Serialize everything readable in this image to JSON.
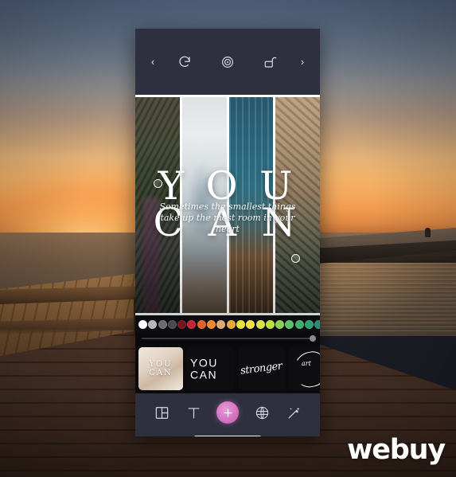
{
  "background": {
    "scene_description": "Sunset over a wooden pier boardwalk with sea wall and ocean",
    "watermark": "webuy",
    "sky_top_color": "#50617c",
    "sky_bottom_color": "#f5a85c",
    "deck_color": "#4c3427"
  },
  "app": {
    "topbar": {
      "back_arrow": "‹",
      "forward_arrow": "›",
      "icons": [
        {
          "name": "undo-redo-icon",
          "label": "Redo"
        },
        {
          "name": "target-icon",
          "label": "Focus"
        },
        {
          "name": "lock-icon",
          "label": "Lock"
        }
      ]
    },
    "canvas": {
      "strips": [
        {
          "name": "strip-1",
          "tone": "mossy green rock"
        },
        {
          "name": "strip-2",
          "tone": "pale grey sky"
        },
        {
          "name": "strip-3",
          "tone": "teal blue glass"
        },
        {
          "name": "strip-4",
          "tone": "tan brown stone"
        }
      ],
      "headline_line1": "Y O U",
      "headline_line2": "C A N",
      "script_text": "Sometimes the smallest things take up the most room in your heart"
    },
    "palette": {
      "label": "Color palette",
      "colors": [
        "#ffffff",
        "#b6b6b6",
        "#6d6d6d",
        "#4a4a4a",
        "#7a1420",
        "#c32533",
        "#e0622b",
        "#ef8a2c",
        "#d8ab74",
        "#e8a83a",
        "#e8e23c",
        "#efe04a",
        "#d7e24a",
        "#b9de3e",
        "#8ed052",
        "#5fc06a",
        "#3fae6c",
        "#2f9e72",
        "#1f8f78"
      ]
    },
    "slider": {
      "label": "Size slider",
      "value": 100
    },
    "thumbnails": {
      "label": "Text style presets",
      "items": [
        {
          "name": "preset-photo-youcan",
          "line1": "YOU",
          "line2": "CAN"
        },
        {
          "name": "preset-bold-youcan",
          "line1": "YOU",
          "line2": "CAN"
        },
        {
          "name": "preset-script-stronger",
          "script": "stronger"
        },
        {
          "name": "preset-brush-mark",
          "script": "art"
        },
        {
          "name": "preset-partial",
          "script": ""
        }
      ]
    },
    "bottombar": {
      "items": [
        {
          "name": "layout-icon",
          "label": "Layout"
        },
        {
          "name": "text-icon",
          "label": "Text"
        },
        {
          "name": "add-icon",
          "label": "Add"
        },
        {
          "name": "sticker-icon",
          "label": "Sticker"
        },
        {
          "name": "magic-wand-icon",
          "label": "Effects"
        }
      ],
      "accent_color": "#d978c4"
    }
  }
}
